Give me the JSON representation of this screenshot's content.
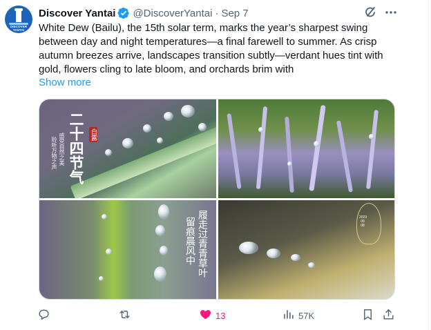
{
  "author": {
    "name": "Discover Yantai",
    "handle": "@DiscoverYantai",
    "separator": "·",
    "date": "Sep 7",
    "avatar_text": "DISCOVER YANTAI",
    "verified_color": "#1d9bf0"
  },
  "tweet": {
    "text": "White Dew (Bailu), the 15th solar term, marks the year’s sharpest swing between day and night temperatures—a final farewell to summer. As crisp autumn breezes arrive, landscapes transition subtly—verdant hues tint with gold, flowers cling to late bloom, and orchards brim with",
    "show_more": "Show more"
  },
  "media": {
    "tile1": {
      "title_cn": "二十四节气",
      "seal_cn": "白露",
      "line1_cn": "感受自然之美",
      "line2_cn": "聆听万物之声"
    },
    "tile3": {
      "col1_cn": "履走过青青草叶",
      "col2_cn": "留痕晨风中"
    },
    "tile4": {
      "date_text": "2023 09 08"
    }
  },
  "actions": {
    "reply_count": "",
    "retweet_count": "",
    "like_count": "13",
    "views_count": "57K"
  },
  "colors": {
    "accent": "#1d9bf0",
    "like": "#f91880",
    "secondary_text": "#536471"
  }
}
